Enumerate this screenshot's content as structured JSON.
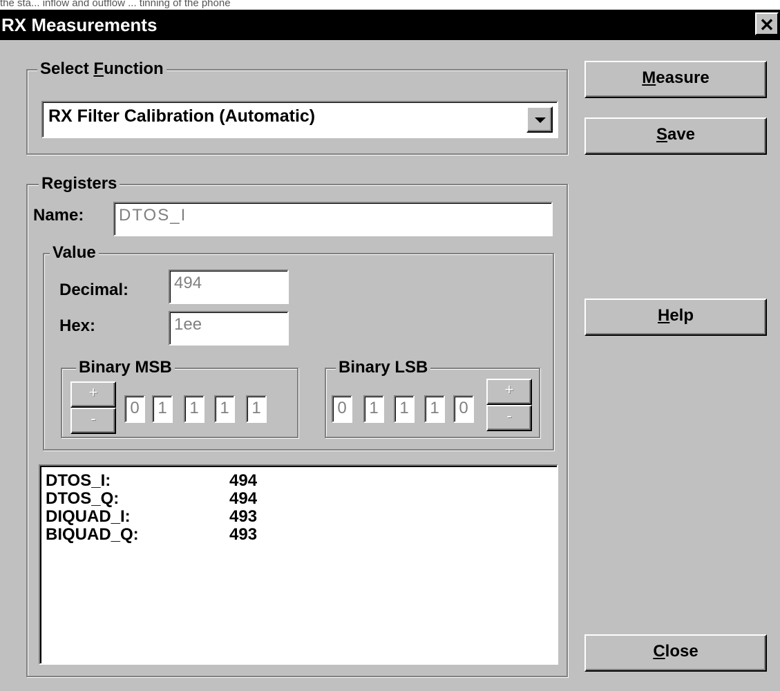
{
  "top_strip_text": "the sta... inflow and outflow ... tinning of the phone",
  "window": {
    "title": "RX Measurements",
    "close_glyph": "✕"
  },
  "function_group": {
    "legend_pre": "Select ",
    "legend_mnemonic": "F",
    "legend_post": "unction",
    "selected": "RX Filter Calibration (Automatic)"
  },
  "buttons": {
    "measure": {
      "mnemonic": "M",
      "rest": "easure"
    },
    "save": {
      "mnemonic": "S",
      "rest": "ave"
    },
    "help": {
      "mnemonic": "H",
      "rest": "elp"
    },
    "close": {
      "mnemonic": "C",
      "rest": "lose"
    }
  },
  "registers": {
    "legend": "Registers",
    "name_label": "Name:",
    "name_value": "DTOS_I",
    "value_group": {
      "legend": "Value",
      "decimal_label": "Decimal:",
      "decimal_value": "494",
      "hex_label": "Hex:",
      "hex_value": "1ee"
    },
    "msb": {
      "legend": "Binary MSB",
      "bits": [
        "0",
        "1",
        "1",
        "1",
        "1"
      ],
      "plus": "+",
      "minus": "-"
    },
    "lsb": {
      "legend": "Binary LSB",
      "bits": [
        "0",
        "1",
        "1",
        "1",
        "0"
      ],
      "plus": "+",
      "minus": "-"
    }
  },
  "results": [
    {
      "name": "DTOS_I:",
      "value": "494"
    },
    {
      "name": "DTOS_Q:",
      "value": "494"
    },
    {
      "name": "DIQUAD_I:",
      "value": "493"
    },
    {
      "name": "BIQUAD_Q:",
      "value": "493"
    }
  ]
}
